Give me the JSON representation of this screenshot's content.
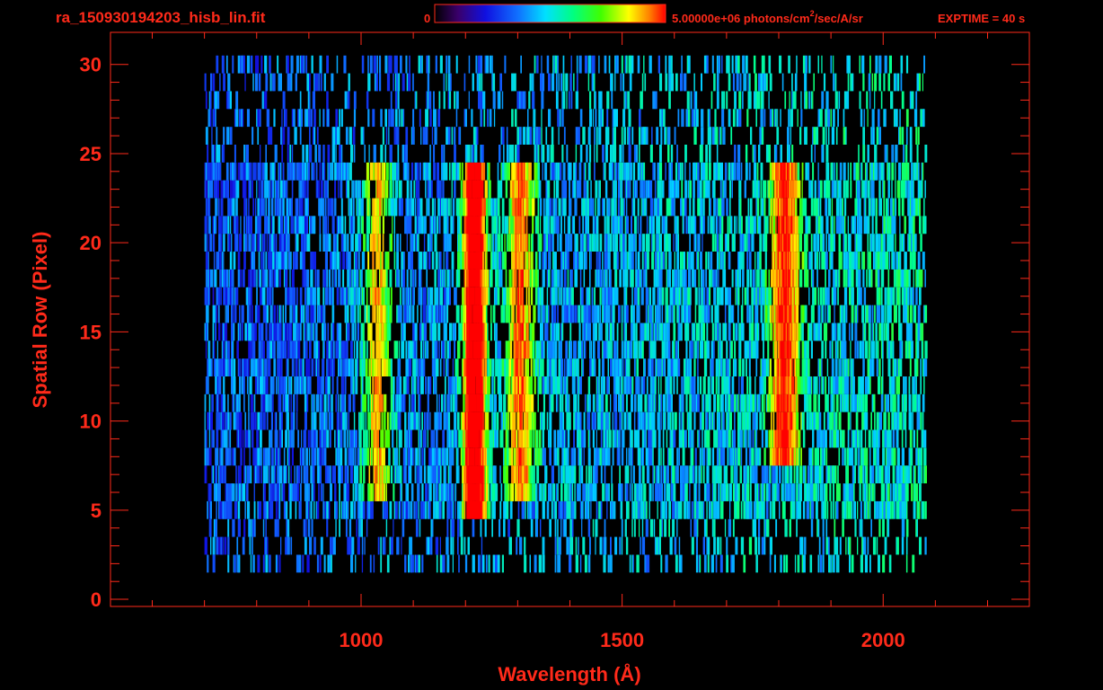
{
  "header": {
    "filename": "ra_150930194203_hisb_lin.fit",
    "colorbar_min": "0",
    "colorbar_max": "5.00000e+06 photons/cm",
    "colorbar_sup": "2",
    "colorbar_rest": "/sec/A/sr",
    "exptime": "EXPTIME = 40 s"
  },
  "colors": {
    "text": "#ff2a1a",
    "axes": "#ff2a1a",
    "background": "#000000",
    "colormap": [
      "#000000",
      "#3a006a",
      "#1010e0",
      "#1060ff",
      "#00d0ff",
      "#00ff90",
      "#40ff00",
      "#ffff00",
      "#ff8000",
      "#ff0000"
    ]
  },
  "chart_data": {
    "type": "heatmap",
    "title": "",
    "xlabel": "Wavelength (Å)",
    "ylabel": "Spatial Row (Pixel)",
    "xlim": [
      520,
      2280
    ],
    "ylim": [
      -0.4,
      31.8
    ],
    "x_ticks": [
      1000,
      1500,
      2000
    ],
    "x_ticklabels": [
      "1000",
      "1500",
      "2000"
    ],
    "y_ticks": [
      0,
      5,
      10,
      15,
      20,
      25,
      30
    ],
    "y_ticklabels": [
      "0",
      "5",
      "10",
      "15",
      "20",
      "25",
      "30"
    ],
    "colorbar_range": [
      0,
      5000000
    ],
    "colorbar_unit": "photons/cm^2/sec/A/sr",
    "colorscale": "rainbow",
    "data_extent": {
      "wavelength": [
        700,
        2080
      ],
      "rows": [
        2,
        30
      ]
    },
    "features": [
      {
        "name": "bright emission line",
        "wavelength": 1216,
        "rows": [
          5,
          24
        ],
        "relative_intensity": 0.9
      },
      {
        "name": "enhanced emission",
        "wavelength": 1304,
        "rows": [
          6,
          24
        ],
        "relative_intensity": 0.5
      },
      {
        "name": "enhanced emission",
        "wavelength": 1030,
        "rows": [
          6,
          24
        ],
        "relative_intensity": 0.45
      },
      {
        "name": "enhanced emission",
        "wavelength": 1810,
        "rows": [
          8,
          24
        ],
        "relative_intensity": 0.55
      }
    ],
    "grid": false
  }
}
